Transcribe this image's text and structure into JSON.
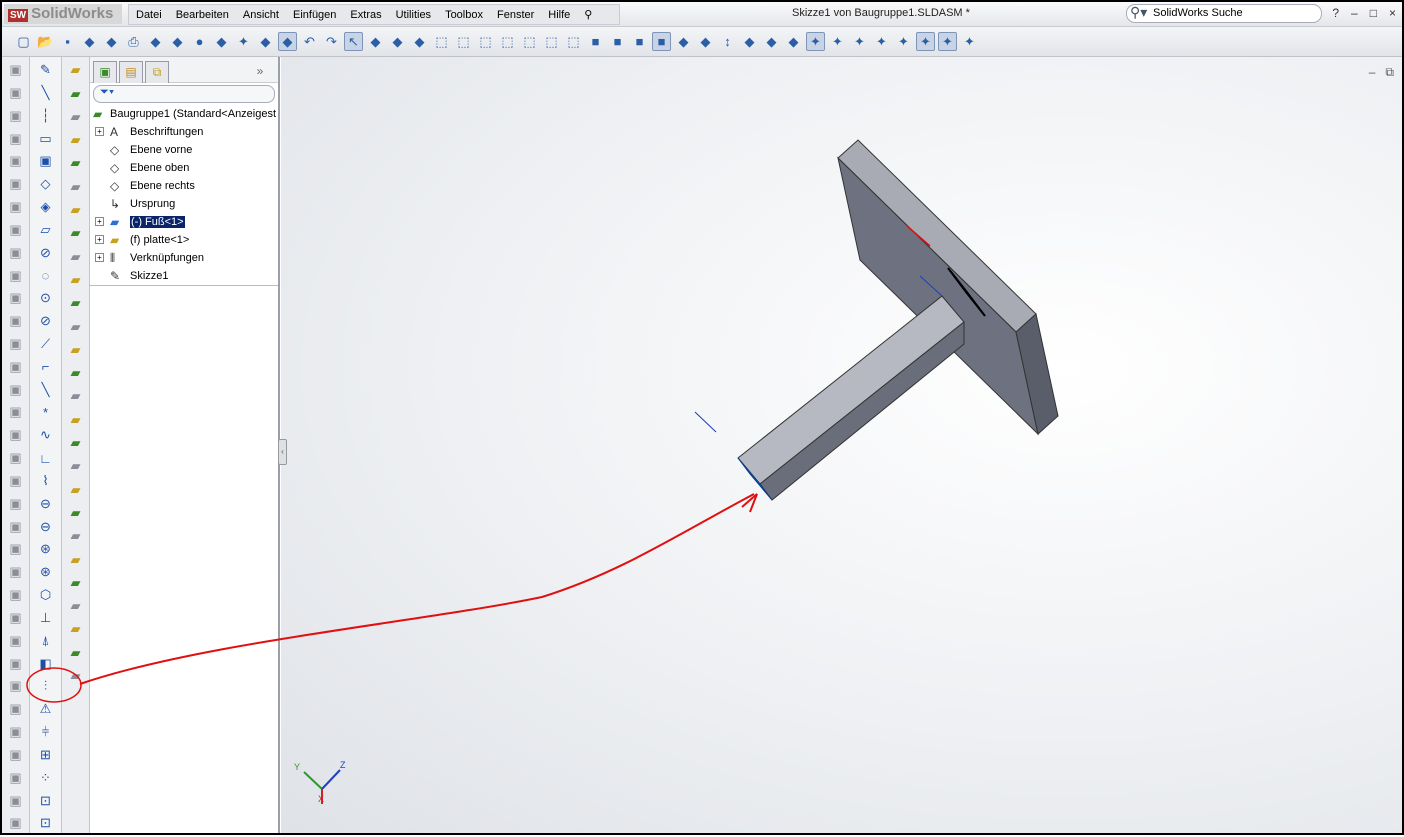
{
  "app": {
    "name": "SolidWorks",
    "logo_badge": "SW",
    "document_title": "Skizze1 von Baugruppe1.SLDASM *"
  },
  "menu": [
    "Datei",
    "Bearbeiten",
    "Ansicht",
    "Einfügen",
    "Extras",
    "Utilities",
    "Toolbox",
    "Fenster",
    "Hilfe"
  ],
  "search": {
    "placeholder": "SolidWorks Suche"
  },
  "window_controls": [
    "?",
    "–",
    "□",
    "×"
  ],
  "viewport_controls": [
    "–",
    "⧉"
  ],
  "toolbar_icons": [
    "new",
    "open",
    "save",
    "print-preview-grid",
    "rebuild-options",
    "print",
    "print-preview",
    "options-list",
    "traffic-light",
    "copy-files",
    "sketch-edit",
    "insert-pin",
    "smart-dimension",
    "undo",
    "redo",
    "select",
    "appearance",
    "sphere",
    "pick-tool",
    "view-cube-1",
    "view-cube-2",
    "view-cube-3",
    "view-cube-4",
    "view-cube-5",
    "view-cube-6",
    "view-cube-7",
    "shaded-1",
    "shaded-2",
    "shaded-3",
    "shaded-active",
    "section-view",
    "box",
    "move",
    "zoom-fit",
    "glasses",
    "display-relation",
    "sketch-1",
    "sketch-2",
    "sketch-3",
    "sketch-4",
    "sketch-5",
    "sketch-6",
    "sketch-7",
    "sketch-8"
  ],
  "tree": {
    "tabs": [
      "feature-manager",
      "property-manager",
      "configuration-manager"
    ],
    "more": "»",
    "filter": "▾",
    "root": "Baugruppe1  (Standard<Anzeigest",
    "items": [
      {
        "label": "Beschriftungen",
        "expand": true,
        "icon": "A"
      },
      {
        "label": "Ebene vorne",
        "expand": false,
        "icon": "◇"
      },
      {
        "label": "Ebene oben",
        "expand": false,
        "icon": "◇"
      },
      {
        "label": "Ebene rechts",
        "expand": false,
        "icon": "◇"
      },
      {
        "label": "Ursprung",
        "expand": false,
        "icon": "↳"
      },
      {
        "label": "(-) Fuß<1>",
        "expand": true,
        "icon": "▰",
        "selected": true
      },
      {
        "label": "(f) platte<1>",
        "expand": true,
        "icon": "▰"
      },
      {
        "label": "Verknüpfungen",
        "expand": true,
        "icon": "⫴"
      },
      {
        "label": "Skizze1",
        "expand": false,
        "icon": "✎"
      }
    ]
  },
  "triad": {
    "x": "X",
    "y": "Y",
    "z": "Z"
  },
  "colors": {
    "annotation": "#e01010",
    "body": "#7a7f8c",
    "selected_face": "#2f7fe8"
  }
}
